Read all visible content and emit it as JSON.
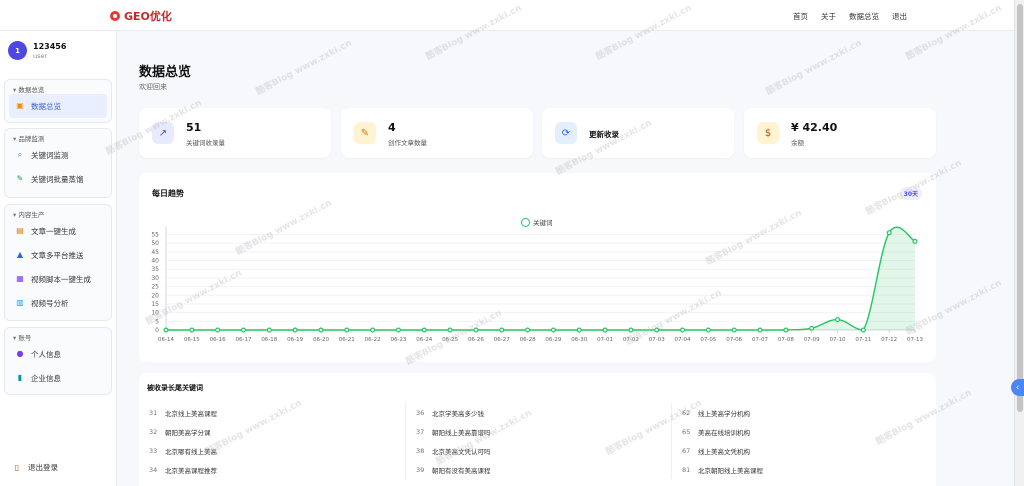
{
  "brand": {
    "name": "GEO优化"
  },
  "nav": [
    "首页",
    "关于",
    "数据总览",
    "退出"
  ],
  "user": {
    "avatar": "1",
    "name": "123456",
    "role": "user"
  },
  "sidebar": {
    "groups": [
      {
        "title": "数据总览",
        "items": [
          {
            "label": "数据总览",
            "icon": "dashboard-icon",
            "active": true
          }
        ]
      },
      {
        "title": "品牌监测",
        "items": [
          {
            "label": "关键词监测",
            "icon": "magnifier-icon"
          },
          {
            "label": "关键词批量蒸馏",
            "icon": "pen-icon"
          }
        ]
      },
      {
        "title": "内容生产",
        "items": [
          {
            "label": "文章一键生成",
            "icon": "document-icon"
          },
          {
            "label": "文章多平台推送",
            "icon": "push-icon"
          },
          {
            "label": "视频脚本一键生成",
            "icon": "clapper-icon"
          },
          {
            "label": "视频号分析",
            "icon": "bar-chart-icon"
          }
        ]
      },
      {
        "title": "账号",
        "items": [
          {
            "label": "个人信息",
            "icon": "person-icon"
          },
          {
            "label": "企业信息",
            "icon": "building-icon"
          }
        ]
      }
    ],
    "logout": "退出登录"
  },
  "page": {
    "title": "数据总览",
    "subtitle": "欢迎回来"
  },
  "cards": [
    {
      "value": "51",
      "label": "关键词收录量",
      "icon": "trend-icon",
      "bg": "#e6ebff"
    },
    {
      "value": "4",
      "label": "创作文章数量",
      "icon": "memo-icon",
      "bg": "#fff3d1"
    },
    {
      "value": "",
      "label": "更新收录",
      "icon": "refresh-icon",
      "bg": "#e3effd"
    },
    {
      "value": "¥ 42.40",
      "label": "余额",
      "icon": "money-bag-icon",
      "bg": "#fff3d1"
    }
  ],
  "chart": {
    "title": "每日趋势",
    "badge": "30天"
  },
  "chart_data": {
    "type": "area",
    "legend": "关键词",
    "categories": [
      "06-14",
      "06-15",
      "06-16",
      "06-17",
      "06-18",
      "06-19",
      "06-20",
      "06-21",
      "06-22",
      "06-23",
      "06-24",
      "06-25",
      "06-26",
      "06-27",
      "06-28",
      "06-29",
      "06-30",
      "07-01",
      "07-02",
      "07-03",
      "07-04",
      "07-05",
      "07-06",
      "07-07",
      "07-08",
      "07-09",
      "07-10",
      "07-11",
      "07-12",
      "07-13"
    ],
    "series": [
      {
        "name": "关键词",
        "values": [
          0,
          0,
          0,
          0,
          0,
          0,
          0,
          0,
          0,
          0,
          0,
          0,
          0,
          0,
          0,
          0,
          0,
          0,
          0,
          0,
          0,
          0,
          0,
          0,
          0,
          1,
          6,
          0,
          56,
          51
        ]
      }
    ],
    "yticks": [
      0,
      5,
      10,
      15,
      20,
      25,
      30,
      35,
      40,
      45,
      50,
      55
    ],
    "ylim": [
      0,
      57
    ],
    "color": "#22c55e",
    "grid": true
  },
  "keywords": {
    "title": "被收录长尾关键词",
    "columns": [
      [
        {
          "n": "31",
          "t": "北京线上美高课程"
        },
        {
          "n": "32",
          "t": "朝阳美高学分课"
        },
        {
          "n": "33",
          "t": "北京哪有线上美高"
        },
        {
          "n": "34",
          "t": "北京美高课程推荐"
        }
      ],
      [
        {
          "n": "36",
          "t": "北京学美高多少钱"
        },
        {
          "n": "37",
          "t": "朝阳线上美高靠谱吗"
        },
        {
          "n": "38",
          "t": "北京美高文凭认可吗"
        },
        {
          "n": "39",
          "t": "朝阳有没有美高课程"
        }
      ],
      [
        {
          "n": "62",
          "t": "线上美高学分机构"
        },
        {
          "n": "65",
          "t": "美高在线培训机构"
        },
        {
          "n": "67",
          "t": "线上美高文凭机构"
        },
        {
          "n": "81",
          "t": "北京朝阳线上美高课程"
        }
      ]
    ]
  },
  "watermark": "酷客Blog www.zxki.cn"
}
